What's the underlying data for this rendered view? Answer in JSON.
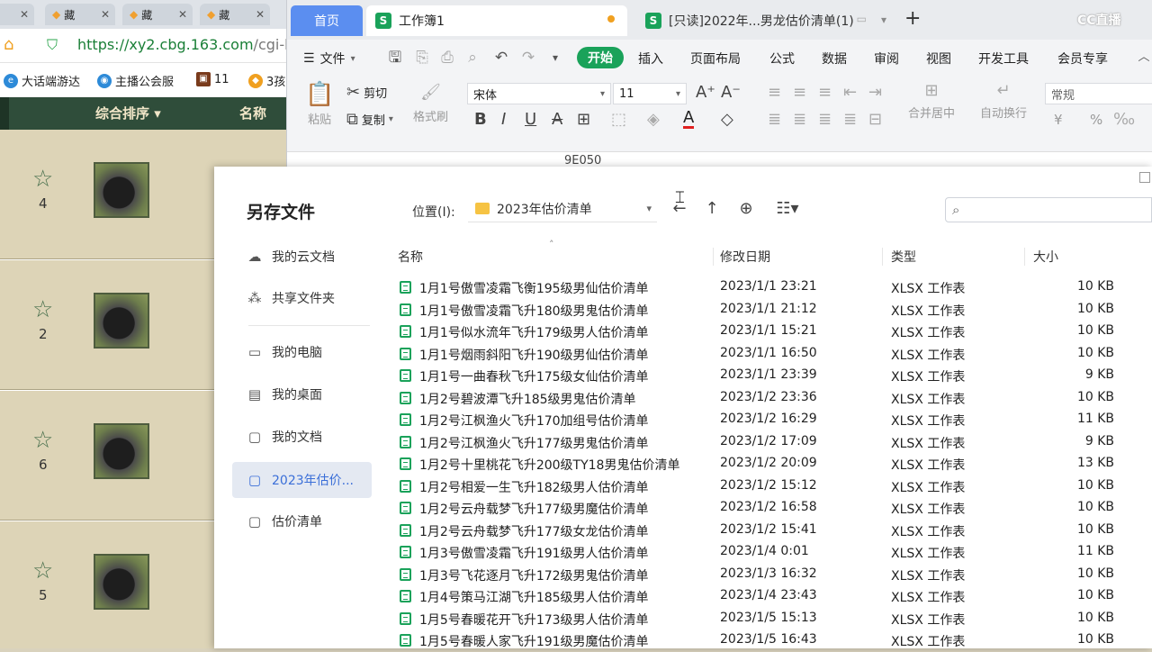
{
  "browser": {
    "tabs": [
      {
        "label": "藏"
      },
      {
        "label": "藏"
      },
      {
        "label": "藏"
      },
      {
        "label": "藏"
      }
    ],
    "url_main": "https://xy2.cbg.163.com",
    "url_path": "/cgi-b",
    "bookmarks": [
      "大话端游达",
      "主播公会服",
      "11",
      "3孩"
    ],
    "table_header": {
      "sort_label": "综合排序 ▾",
      "name_label": "名称"
    },
    "rows": [
      {
        "num": "4"
      },
      {
        "num": "2"
      },
      {
        "num": "6"
      },
      {
        "num": "5"
      }
    ]
  },
  "wps": {
    "home_tab": "首页",
    "doc_tab_1": "工作簿1",
    "doc_tab_2": "[只读]2022年...男龙估价清单(1)",
    "s_icon": "S",
    "cc_logo": "CC直播",
    "menu": {
      "file": "文件",
      "start": "开始",
      "insert": "插入",
      "page_layout": "页面布局",
      "formula": "公式",
      "data": "数据",
      "review": "审阅",
      "view": "视图",
      "dev_tools": "开发工具",
      "member": "会员专享"
    },
    "ribbon": {
      "paste": "粘贴",
      "cut": "剪切",
      "copy": "复制",
      "format_painter": "格式刷",
      "font_name": "宋体",
      "font_size": "11",
      "merge_center": "合并居中",
      "wrap_text": "自动换行",
      "number_format": "常规",
      "currency": "¥",
      "percent": "%"
    },
    "formula_cell": "9E050"
  },
  "dialog": {
    "title": "另存文件",
    "location_label": "位置(I):",
    "location_value": "2023年估价清单",
    "sidebar": [
      {
        "label": "我的云文档",
        "icon": "cloud-icon"
      },
      {
        "label": "共享文件夹",
        "icon": "share-icon"
      },
      {
        "label": "我的电脑",
        "icon": "computer-icon"
      },
      {
        "label": "我的桌面",
        "icon": "desktop-icon"
      },
      {
        "label": "我的文档",
        "icon": "documents-icon"
      },
      {
        "label": "2023年估价...",
        "icon": "folder-icon"
      },
      {
        "label": "估价清单",
        "icon": "folder-icon"
      }
    ],
    "columns": {
      "name": "名称",
      "modified": "修改日期",
      "type": "类型",
      "size": "大小"
    },
    "files": [
      {
        "name": "1月1号傲雪凌霜飞衡195级男仙估价清单",
        "date": "2023/1/1 23:21",
        "type": "XLSX 工作表",
        "size": "10 KB"
      },
      {
        "name": "1月1号傲雪凌霜飞升180级男鬼估价清单",
        "date": "2023/1/1 21:12",
        "type": "XLSX 工作表",
        "size": "10 KB"
      },
      {
        "name": "1月1号似水流年飞升179级男人估价清单",
        "date": "2023/1/1 15:21",
        "type": "XLSX 工作表",
        "size": "10 KB"
      },
      {
        "name": "1月1号烟雨斜阳飞升190级男仙估价清单",
        "date": "2023/1/1 16:50",
        "type": "XLSX 工作表",
        "size": "10 KB"
      },
      {
        "name": "1月1号一曲春秋飞升175级女仙估价清单",
        "date": "2023/1/1 23:39",
        "type": "XLSX 工作表",
        "size": "9 KB"
      },
      {
        "name": "1月2号碧波潭飞升185级男鬼估价清单",
        "date": "2023/1/2 23:36",
        "type": "XLSX 工作表",
        "size": "10 KB"
      },
      {
        "name": "1月2号江枫渔火飞升170加组号估价清单",
        "date": "2023/1/2 16:29",
        "type": "XLSX 工作表",
        "size": "11 KB"
      },
      {
        "name": "1月2号江枫渔火飞升177级男鬼估价清单",
        "date": "2023/1/2 17:09",
        "type": "XLSX 工作表",
        "size": "9 KB"
      },
      {
        "name": "1月2号十里桃花飞升200级TY18男鬼估价清单",
        "date": "2023/1/2 20:09",
        "type": "XLSX 工作表",
        "size": "13 KB"
      },
      {
        "name": "1月2号相爱一生飞升182级男人估价清单",
        "date": "2023/1/2 15:12",
        "type": "XLSX 工作表",
        "size": "10 KB"
      },
      {
        "name": "1月2号云舟载梦飞升177级男魔估价清单",
        "date": "2023/1/2 16:58",
        "type": "XLSX 工作表",
        "size": "10 KB"
      },
      {
        "name": "1月2号云舟载梦飞升177级女龙估价清单",
        "date": "2023/1/2 15:41",
        "type": "XLSX 工作表",
        "size": "10 KB"
      },
      {
        "name": "1月3号傲雪凌霜飞升191级男人估价清单",
        "date": "2023/1/4 0:01",
        "type": "XLSX 工作表",
        "size": "11 KB"
      },
      {
        "name": "1月3号飞花逐月飞升172级男鬼估价清单",
        "date": "2023/1/3 16:32",
        "type": "XLSX 工作表",
        "size": "10 KB"
      },
      {
        "name": "1月4号策马江湖飞升185级男人估价清单",
        "date": "2023/1/4 23:43",
        "type": "XLSX 工作表",
        "size": "10 KB"
      },
      {
        "name": "1月5号春暖花开飞升173级男人估价清单",
        "date": "2023/1/5 15:13",
        "type": "XLSX 工作表",
        "size": "10 KB"
      },
      {
        "name": "1月5号春暖人家飞升191级男魔估价清单",
        "date": "2023/1/5 16:43",
        "type": "XLSX 工作表",
        "size": "10 KB"
      }
    ]
  }
}
